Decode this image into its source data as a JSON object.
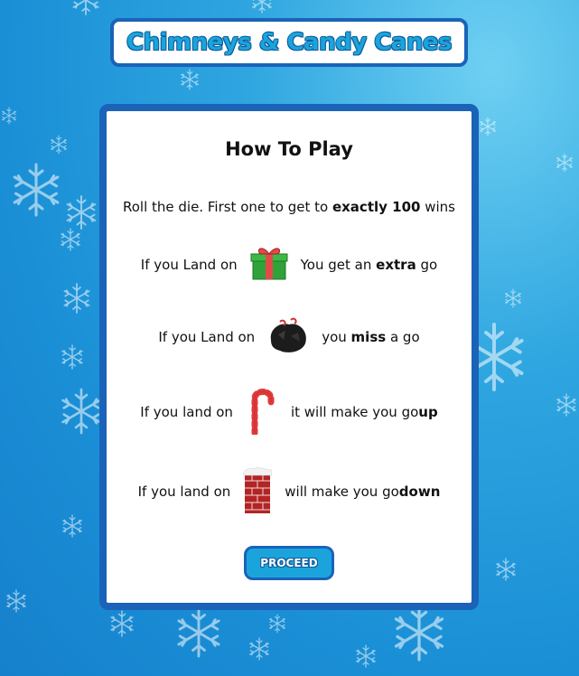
{
  "header": {
    "title": "Chimneys & Candy Canes"
  },
  "card": {
    "heading": "How To Play",
    "intro": {
      "prefix": "Roll the die. First one to get to ",
      "bold": "exactly 100",
      "suffix": " wins"
    },
    "rules": [
      {
        "left": "If you Land on",
        "icon": "gift-icon",
        "right_prefix": "You get an ",
        "right_bold": "extra",
        "right_suffix": " go"
      },
      {
        "left": "If you Land on",
        "icon": "coal-icon",
        "right_prefix": "you ",
        "right_bold": "miss",
        "right_suffix": " a go"
      },
      {
        "left": "If you land on",
        "icon": "candy-cane-icon",
        "right_prefix": "it will make you go ",
        "right_bold": "up",
        "right_suffix": ""
      },
      {
        "left": "If you land on",
        "icon": "chimney-icon",
        "right_prefix": "will make you go ",
        "right_bold": "down",
        "right_suffix": ""
      }
    ],
    "proceed_label": "PROCEED"
  },
  "colors": {
    "accent": "#1ba4dc",
    "border": "#1a63b8",
    "background": "#1a8fd6"
  }
}
